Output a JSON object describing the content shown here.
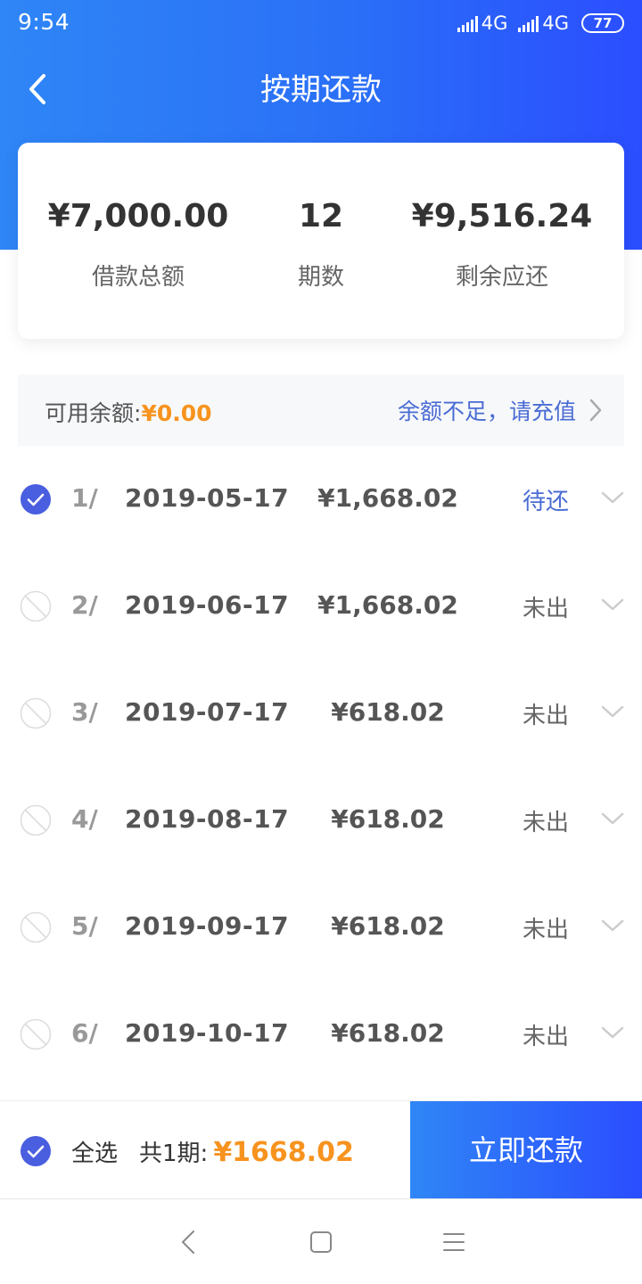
{
  "status_bar": {
    "time": "9:54",
    "network_1": "4G",
    "network_2": "4G",
    "battery": "77"
  },
  "nav": {
    "title": "按期还款",
    "back_icon": "chevron-left-icon"
  },
  "summary": {
    "items": [
      {
        "value": "¥7,000.00",
        "label": "借款总额"
      },
      {
        "value": "12",
        "label": "期数"
      },
      {
        "value": "¥9,516.24",
        "label": "剩余应还"
      }
    ]
  },
  "balance": {
    "label": "可用余额:",
    "value": "¥0.00",
    "recharge_text": "余额不足，请充值"
  },
  "installments": [
    {
      "index": "1/",
      "date": "2019-05-17",
      "amount": "¥1,668.02",
      "status": "待还",
      "checked": true
    },
    {
      "index": "2/",
      "date": "2019-06-17",
      "amount": "¥1,668.02",
      "status": "未出",
      "checked": false
    },
    {
      "index": "3/",
      "date": "2019-07-17",
      "amount": "¥618.02",
      "status": "未出",
      "checked": false
    },
    {
      "index": "4/",
      "date": "2019-08-17",
      "amount": "¥618.02",
      "status": "未出",
      "checked": false
    },
    {
      "index": "5/",
      "date": "2019-09-17",
      "amount": "¥618.02",
      "status": "未出",
      "checked": false
    },
    {
      "index": "6/",
      "date": "2019-10-17",
      "amount": "¥618.02",
      "status": "未出",
      "checked": false
    }
  ],
  "bottom_bar": {
    "select_all_label": "全选",
    "total_prefix": "共1期:",
    "total_amount": "¥1668.02",
    "pay_button_label": "立即还款"
  },
  "colors": {
    "brand_blue": "#2a6ff7",
    "accent_orange": "#f7931e",
    "link_blue": "#4a6cd4",
    "check_blue": "#4a5ee0"
  }
}
